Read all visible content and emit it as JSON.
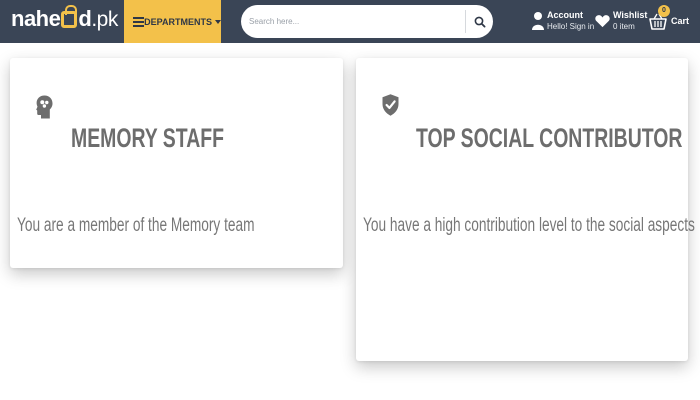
{
  "header": {
    "logo": {
      "part1": "nahe",
      "part2": "d",
      "tail": ".pk"
    },
    "departments_label": "DEPARTMENTS",
    "search": {
      "placeholder": "Search here...",
      "value": ""
    },
    "account": {
      "title": "Account",
      "subtitle": "Hello! Sign in"
    },
    "wishlist": {
      "title": "Wishlist",
      "subtitle": "0 item"
    },
    "cart": {
      "label": "Cart",
      "count": "0"
    }
  },
  "badges": [
    {
      "icon": "brain-head-icon",
      "title": "MEMORY STAFF",
      "description": "You are a member of the Memory team"
    },
    {
      "icon": "shield-check-icon",
      "title": "TOP SOCIAL CONTRIBUTOR",
      "description": "You have a high contribution level to the social aspects"
    }
  ],
  "colors": {
    "header_bg": "#3a4556",
    "accent_yellow": "#f3c14a",
    "card_text": "#6d6d6d"
  }
}
